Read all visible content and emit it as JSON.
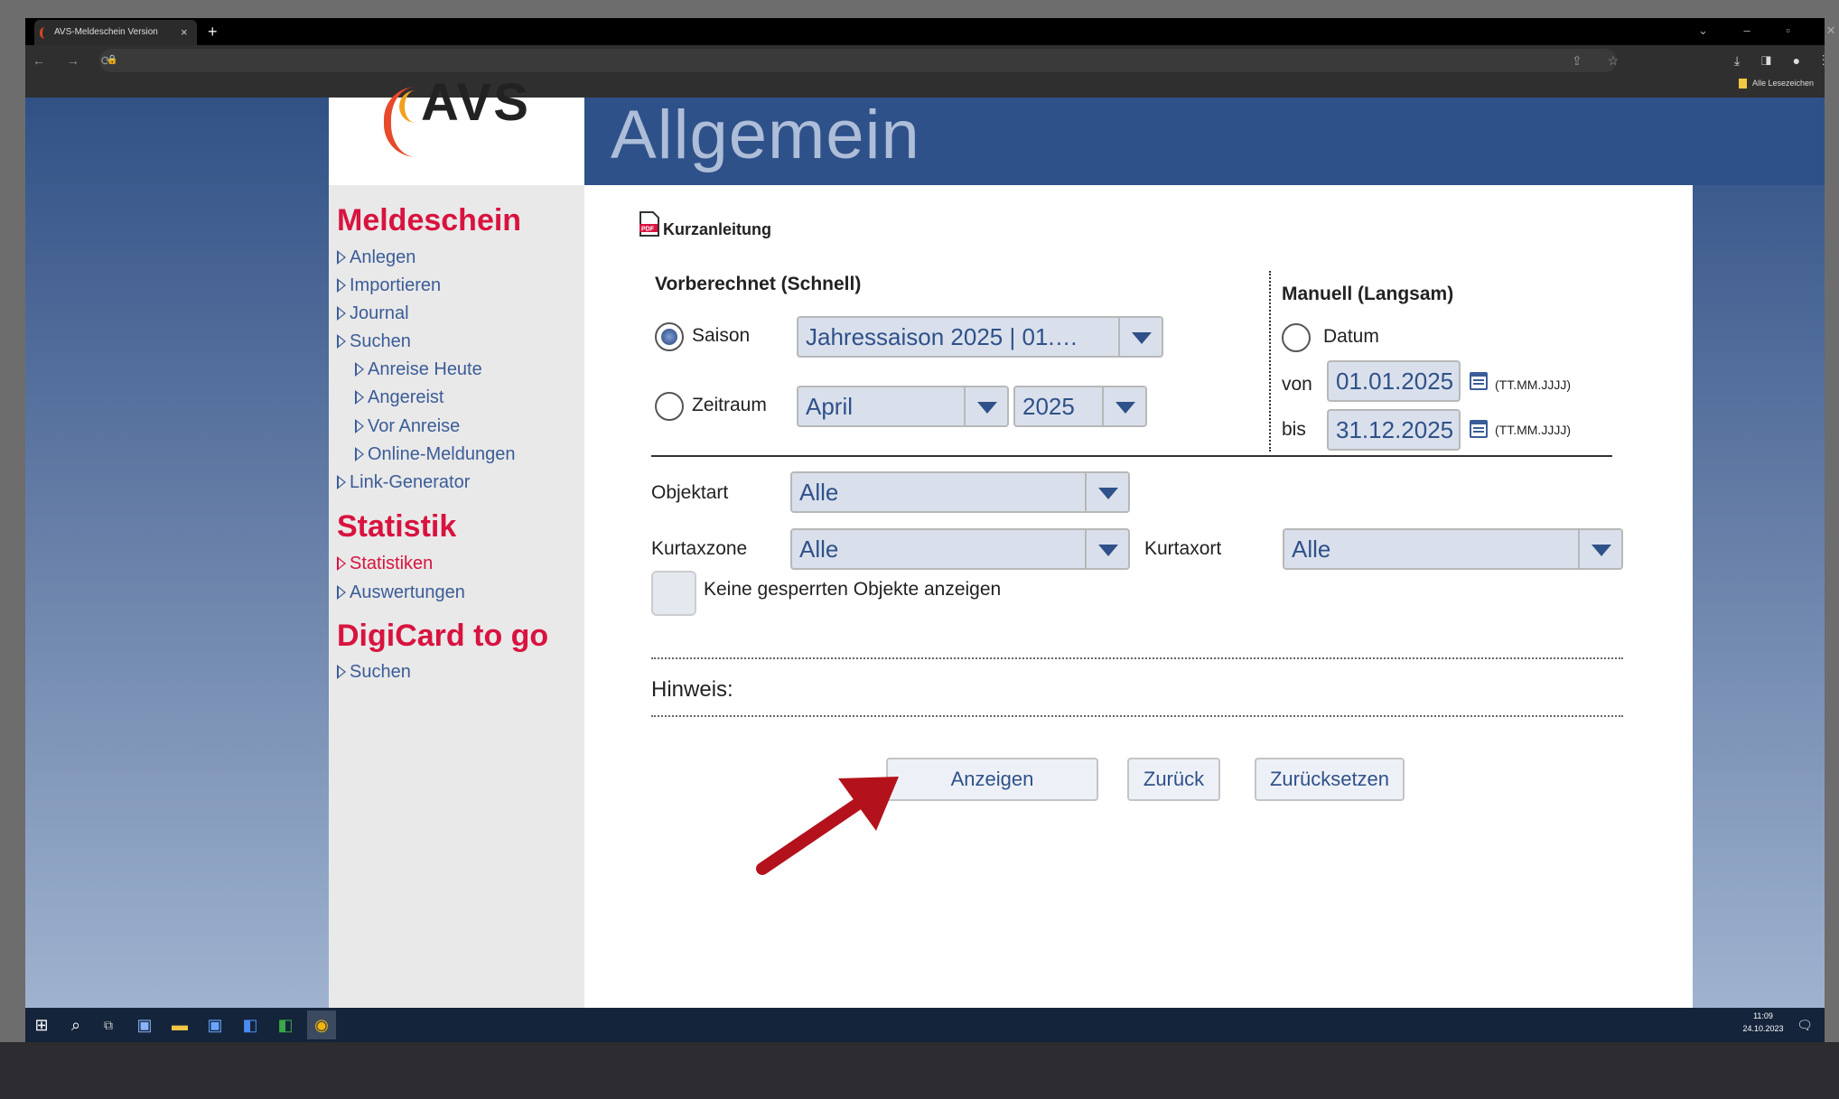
{
  "browser": {
    "tab_title": "AVS-Meldeschein Version",
    "tab_close": "×",
    "new_tab": "+",
    "nav_buttons": "← → ⟳",
    "window_controls": "⌄ – ▫ ✕",
    "url_icons": "⇪ ☆",
    "ext_icons": "⤓ ◨ ● ⋮",
    "bookmarks_label": "Alle Lesezeichen"
  },
  "logo": {
    "text": "AVS"
  },
  "header": {
    "title": "Allgemein"
  },
  "sidebar": {
    "meldeschein": {
      "heading": "Meldeschein",
      "items": [
        "Anlegen",
        "Importieren",
        "Journal",
        "Suchen"
      ],
      "sub_items": [
        "Anreise Heute",
        "Angereist",
        "Vor Anreise",
        "Online-Meldungen"
      ],
      "link_generator": "Link-Generator"
    },
    "statistik": {
      "heading": "Statistik",
      "items": [
        "Statistiken",
        "Auswertungen"
      ]
    },
    "digicard": {
      "heading": "DigiCard to go",
      "items": [
        "Suchen"
      ]
    }
  },
  "content": {
    "kurzanleitung": "Kurzanleitung",
    "vorberechnet": {
      "heading": "Vorberechnet (Schnell)",
      "saison_label": "Saison",
      "saison_value": "Jahressaison 2025 | 01.01.2...",
      "zeitraum_label": "Zeitraum",
      "month_value": "April",
      "year_value": "2025",
      "saison_selected": true
    },
    "manuell": {
      "heading": "Manuell (Langsam)",
      "datum_label": "Datum",
      "von_label": "von",
      "von_value": "01.01.2025",
      "bis_label": "bis",
      "bis_value": "31.12.2025",
      "format_hint": "(TT.MM.JJJJ)"
    },
    "filters": {
      "objektart_label": "Objektart",
      "objektart_value": "Alle",
      "kurtaxzone_label": "Kurtaxzone",
      "kurtaxzone_value": "Alle",
      "kurtaxort_label": "Kurtaxort",
      "kurtaxort_value": "Alle",
      "gesperrte_label": "Keine gesperrten Objekte anzeigen"
    },
    "hinweis_label": "Hinweis:",
    "buttons": {
      "anzeigen": "Anzeigen",
      "zurueck": "Zurück",
      "zuruecksetzen": "Zurücksetzen"
    }
  },
  "taskbar": {
    "time": "11:09",
    "date": "24.10.2023"
  },
  "colors": {
    "brand_red": "#d8133f",
    "nav_blue": "#3b5c98",
    "header_blue": "#2f5189",
    "arrow_red": "#b3121c"
  }
}
